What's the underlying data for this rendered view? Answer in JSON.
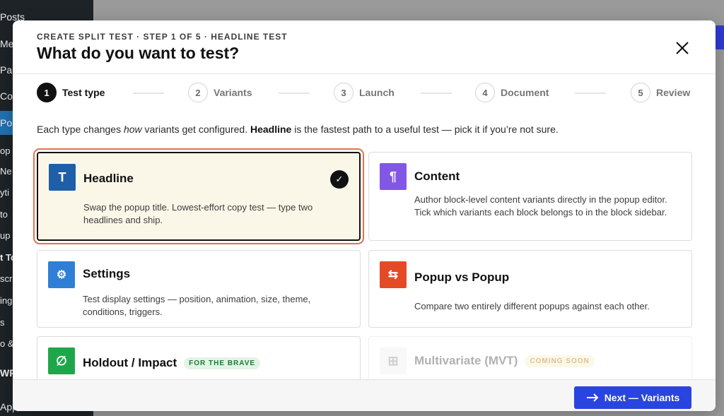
{
  "wp_sidebar": {
    "items": [
      "Posts",
      "Me",
      "Pa",
      "Co",
      "Po",
      "op",
      "Ne",
      "yti",
      "to",
      "up",
      "t To",
      "scr",
      "ing",
      "s",
      "o &",
      "WP",
      "App"
    ]
  },
  "modal": {
    "eyebrow": "CREATE SPLIT TEST · STEP 1 OF 5 · HEADLINE TEST",
    "title": "What do you want to test?",
    "close_icon": "close-icon"
  },
  "stepper": {
    "steps": [
      {
        "num": "1",
        "label": "Test type"
      },
      {
        "num": "2",
        "label": "Variants"
      },
      {
        "num": "3",
        "label": "Launch"
      },
      {
        "num": "4",
        "label": "Document"
      },
      {
        "num": "5",
        "label": "Review"
      }
    ],
    "active_step": 1
  },
  "intro": {
    "part1": "Each type changes ",
    "emph": "how",
    "part2": " variants get configured. ",
    "bold": "Headline",
    "part3": " is the fastest path to a useful test — pick it if you’re not sure."
  },
  "cards": {
    "headline": {
      "icon": "T",
      "icon_name": "text-icon",
      "color": "#1e5fa8",
      "title": "Headline",
      "desc": "Swap the popup title. Lowest-effort copy test — type two headlines and ship.",
      "selected": true,
      "check": "✓"
    },
    "content": {
      "icon": "¶",
      "icon_name": "paragraph-icon",
      "color": "#8257e6",
      "title": "Content",
      "desc": "Author block-level content variants directly in the popup editor. Tick which variants each block belongs to in the block sidebar."
    },
    "settings": {
      "icon": "⚙",
      "icon_name": "gear-icon",
      "color": "#2f7fd6",
      "title": "Settings",
      "desc": "Test display settings — position, animation, size, theme, conditions, triggers."
    },
    "popup_vs_popup": {
      "icon": "⇆",
      "icon_name": "swap-icon",
      "color": "#e44a26",
      "title": "Popup vs Popup",
      "desc": "Compare two entirely different popups against each other."
    },
    "holdout": {
      "icon": "∅",
      "icon_name": "holdout-icon",
      "color": "#1fa64a",
      "title": "Holdout / Impact",
      "badge": "FOR THE BRAVE"
    },
    "mvt": {
      "icon": "⊞",
      "icon_name": "grid-icon",
      "color": "#dadada",
      "title": "Multivariate (MVT)",
      "badge": "COMING SOON"
    }
  },
  "footer": {
    "next_label": "Next — Variants",
    "arrow_icon": "arrow-right-icon"
  },
  "colors": {
    "accent": "#2a44e0",
    "selected_outline": "#e2734a"
  }
}
